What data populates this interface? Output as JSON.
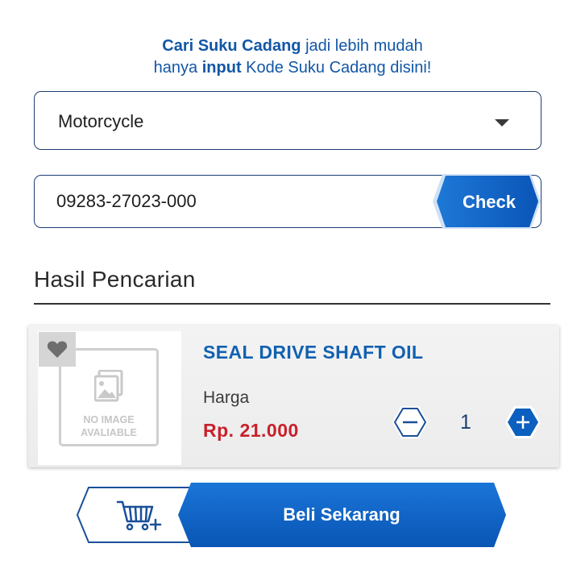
{
  "intro": {
    "line1_bold": "Cari Suku Cadang",
    "line1_rest": " jadi lebih mudah",
    "line2_start": "hanya ",
    "line2_bold": "input",
    "line2_rest": " Kode Suku Cadang disini!"
  },
  "vehicle_select": {
    "value": "Motorcycle",
    "icon": "chevron-down-icon"
  },
  "search": {
    "value": "09283-27023-000",
    "button_label": "Check"
  },
  "results": {
    "title": "Hasil Pencarian",
    "items": [
      {
        "name": "SEAL DRIVE SHAFT OIL",
        "price_label": "Harga",
        "price": "Rp. 21.000",
        "quantity": "1",
        "image_placeholder_line1": "NO IMAGE",
        "image_placeholder_line2": "AVALIABLE"
      }
    ]
  },
  "actions": {
    "buy_label": "Beli Sekarang",
    "cart_icon": "add-to-cart-icon"
  },
  "colors": {
    "accent": "#0b63c9",
    "navy": "#1c3f73",
    "price": "#c8202b",
    "title_blue": "#1161b0"
  }
}
